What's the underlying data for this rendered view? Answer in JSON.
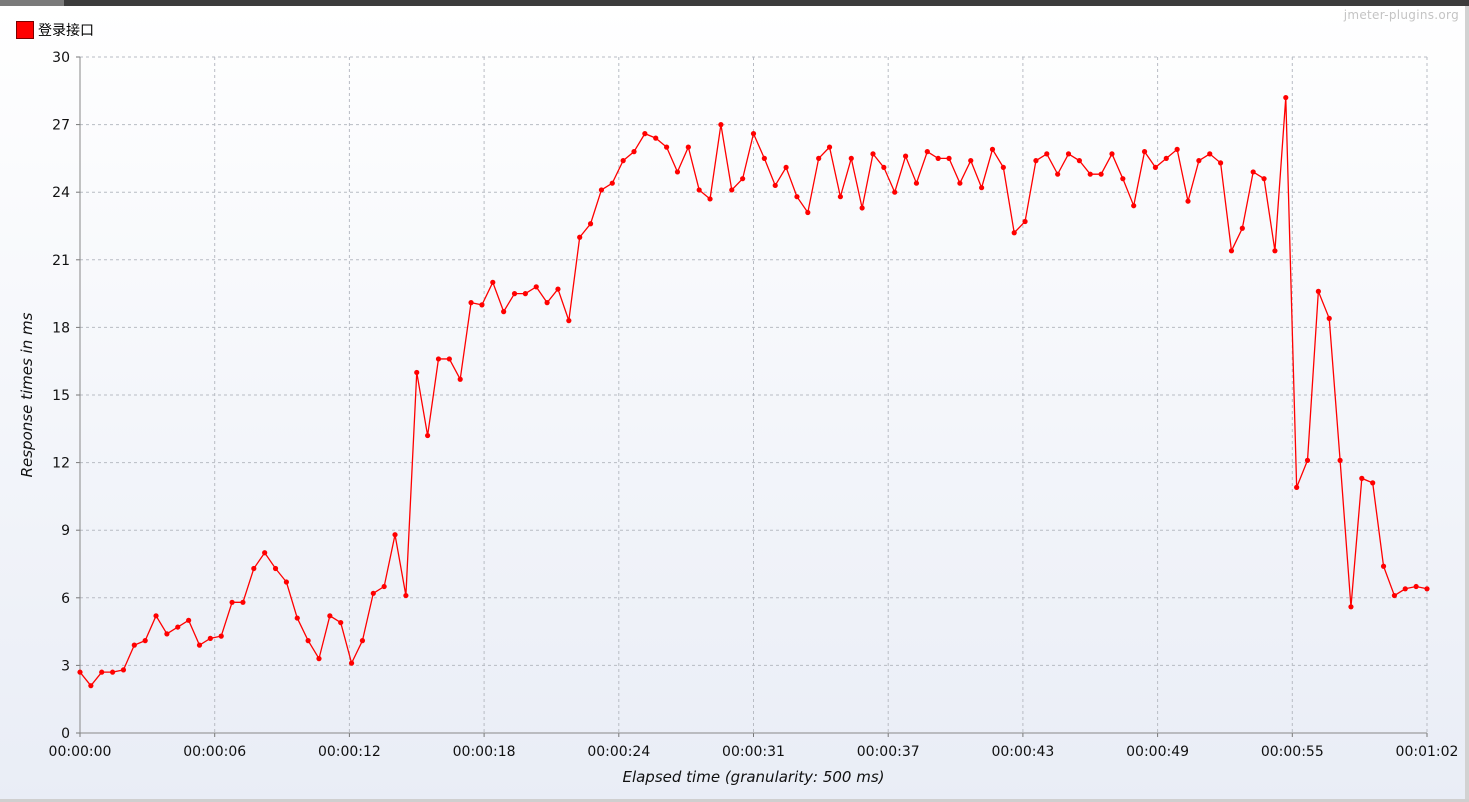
{
  "window": {
    "watermark": "jmeter-plugins.org"
  },
  "legend": {
    "label": "登录接口",
    "color": "#ff0000"
  },
  "chart_data": {
    "type": "line",
    "title": "",
    "xlabel": "Elapsed time (granularity: 500 ms)",
    "ylabel": "Response times in ms",
    "ylim": [
      0,
      30
    ],
    "yticks": [
      0,
      3,
      6,
      9,
      12,
      15,
      18,
      21,
      24,
      27,
      30
    ],
    "xlim_seconds": [
      0,
      62
    ],
    "xtick_labels": [
      "00:00:00",
      "00:00:06",
      "00:00:12",
      "00:00:18",
      "00:00:24",
      "00:00:31",
      "00:00:37",
      "00:00:43",
      "00:00:49",
      "00:00:55",
      "00:01:02"
    ],
    "grid": true,
    "legend_position": "top-left",
    "series": [
      {
        "name": "登录接口",
        "color": "#ff0000",
        "x_step_seconds": 0.5,
        "values": [
          2.7,
          2.1,
          2.7,
          2.7,
          2.8,
          3.9,
          4.1,
          5.2,
          4.4,
          4.7,
          5.0,
          3.9,
          4.2,
          4.3,
          5.8,
          5.8,
          7.3,
          8.0,
          7.3,
          6.7,
          5.1,
          4.1,
          3.3,
          5.2,
          4.9,
          3.1,
          4.1,
          6.2,
          6.5,
          8.8,
          6.1,
          16.0,
          13.2,
          16.6,
          16.6,
          15.7,
          19.1,
          19.0,
          20.0,
          18.7,
          19.5,
          19.5,
          19.8,
          19.1,
          19.7,
          18.3,
          22.0,
          22.6,
          24.1,
          24.4,
          25.4,
          25.8,
          26.6,
          26.4,
          26.0,
          24.9,
          26.0,
          24.1,
          23.7,
          27.0,
          24.1,
          24.6,
          26.6,
          25.5,
          24.3,
          25.1,
          23.8,
          23.1,
          25.5,
          26.0,
          23.8,
          25.5,
          23.3,
          25.7,
          25.1,
          24.0,
          25.6,
          24.4,
          25.8,
          25.5,
          25.5,
          24.4,
          25.4,
          24.2,
          25.9,
          25.1,
          22.2,
          22.7,
          25.4,
          25.7,
          24.8,
          25.7,
          25.4,
          24.8,
          24.8,
          25.7,
          24.6,
          23.4,
          25.8,
          25.1,
          25.5,
          25.9,
          23.6,
          25.4,
          25.7,
          25.3,
          21.4,
          22.4,
          24.9,
          24.6,
          21.4,
          28.2,
          10.9,
          12.1,
          19.6,
          18.4,
          12.1,
          5.6,
          11.3,
          11.1,
          7.4,
          6.1,
          6.4,
          6.5,
          6.4
        ]
      }
    ]
  }
}
